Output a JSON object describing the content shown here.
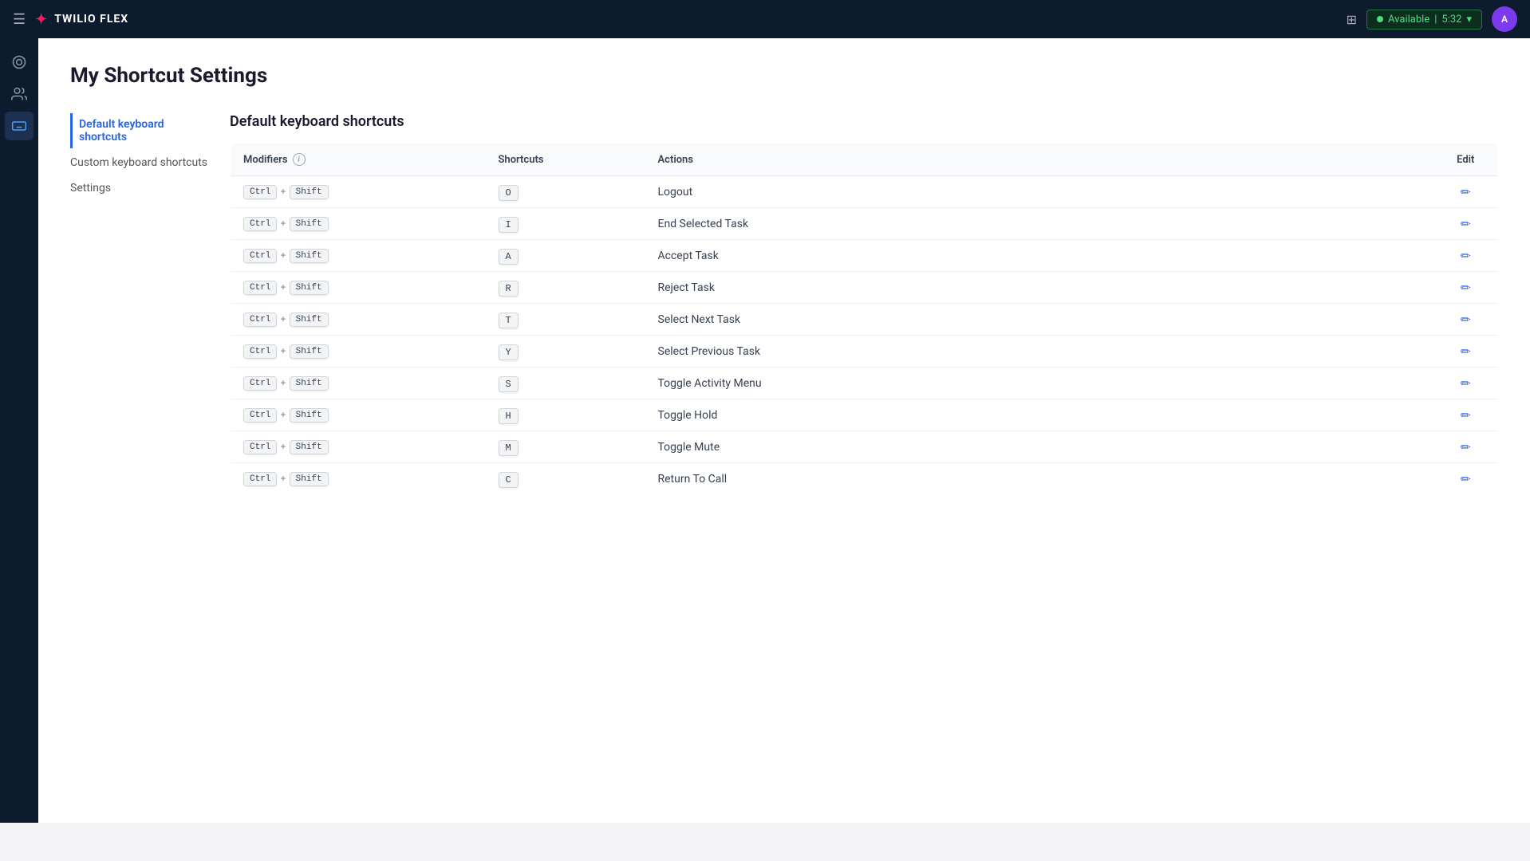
{
  "brand": {
    "name": "TWILIO FLEX"
  },
  "status": {
    "label": "Available",
    "time": "5:32"
  },
  "page": {
    "title": "My Shortcut Settings"
  },
  "sidebar_nav": {
    "items": [
      {
        "id": "default",
        "label": "Default keyboard shortcuts",
        "active": true
      },
      {
        "id": "custom",
        "label": "Custom keyboard shortcuts",
        "active": false
      },
      {
        "id": "settings",
        "label": "Settings",
        "active": false
      }
    ]
  },
  "section": {
    "title": "Default keyboard shortcuts"
  },
  "table": {
    "columns": [
      "Modifiers",
      "Shortcuts",
      "Actions",
      "Edit"
    ],
    "rows": [
      {
        "modifier": "Ctrl + Shift",
        "shortcut": "O",
        "action": "Logout"
      },
      {
        "modifier": "Ctrl + Shift",
        "shortcut": "I",
        "action": "End Selected Task"
      },
      {
        "modifier": "Ctrl + Shift",
        "shortcut": "A",
        "action": "Accept Task"
      },
      {
        "modifier": "Ctrl + Shift",
        "shortcut": "R",
        "action": "Reject Task"
      },
      {
        "modifier": "Ctrl + Shift",
        "shortcut": "T",
        "action": "Select Next Task"
      },
      {
        "modifier": "Ctrl + Shift",
        "shortcut": "Y",
        "action": "Select Previous Task"
      },
      {
        "modifier": "Ctrl + Shift",
        "shortcut": "S",
        "action": "Toggle Activity Menu"
      },
      {
        "modifier": "Ctrl + Shift",
        "shortcut": "H",
        "action": "Toggle Hold"
      },
      {
        "modifier": "Ctrl + Shift",
        "shortcut": "M",
        "action": "Toggle Mute"
      },
      {
        "modifier": "Ctrl + Shift",
        "shortcut": "C",
        "action": "Return To Call"
      }
    ]
  }
}
